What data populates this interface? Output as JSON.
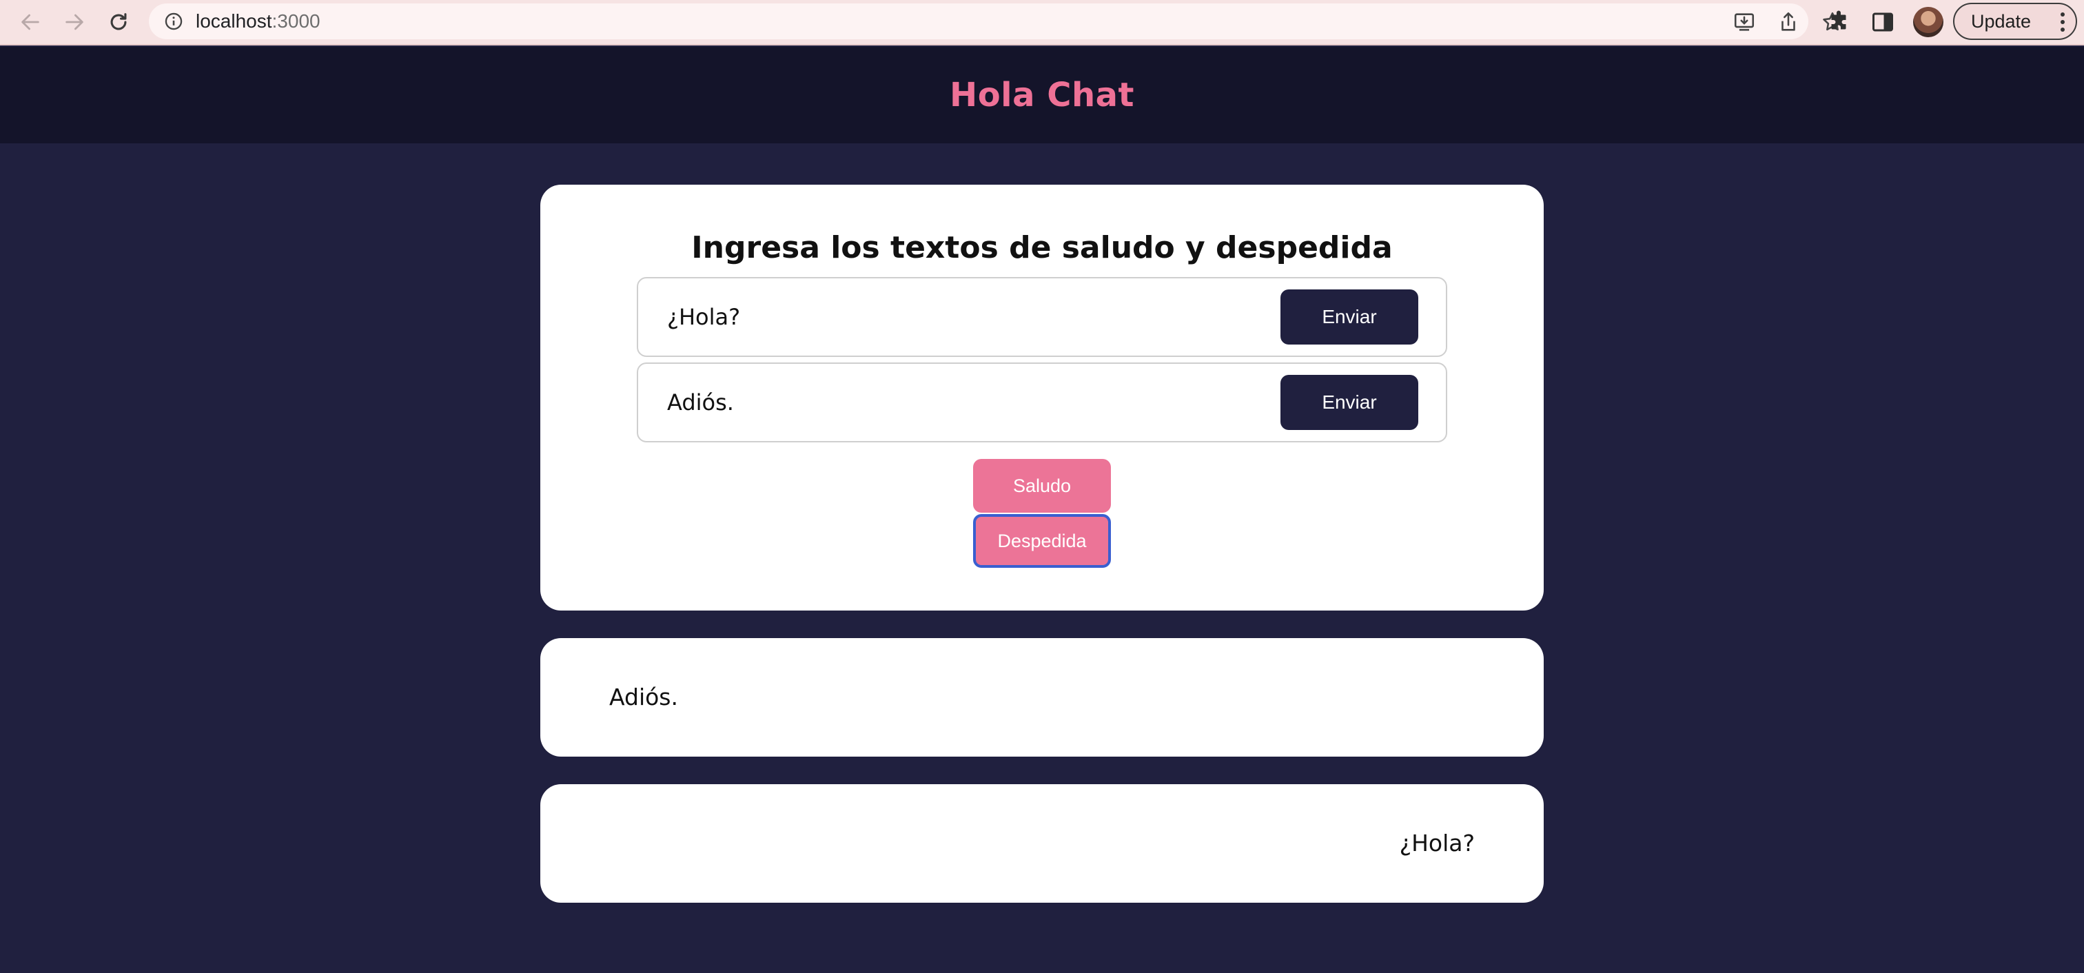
{
  "browser": {
    "url_host": "localhost",
    "url_port": ":3000",
    "update_label": "Update"
  },
  "app": {
    "title": "Hola Chat"
  },
  "form": {
    "heading": "Ingresa los textos de saludo y despedida",
    "greeting_value": "¿Hola?",
    "farewell_value": "Adiós.",
    "send_label_1": "Enviar",
    "send_label_2": "Enviar",
    "saludo_label": "Saludo",
    "despedida_label": "Despedida"
  },
  "messages": [
    {
      "text": "Adiós.",
      "align": "left"
    },
    {
      "text": "¿Hola?",
      "align": "right"
    }
  ],
  "colors": {
    "accent_pink": "#ec7497",
    "navy": "#20203f",
    "header_dark": "#14142a"
  }
}
